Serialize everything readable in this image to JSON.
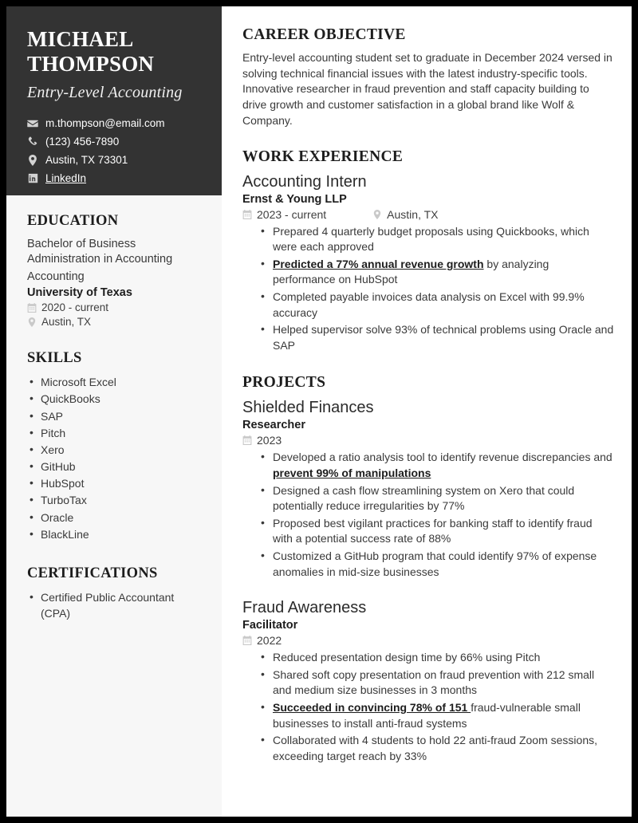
{
  "theme": {
    "page_border": "#000000",
    "header_bg": "#333333",
    "sidebar_bg": "#f7f7f7",
    "main_bg": "#ffffff",
    "text_primary": "#1d1d1d",
    "text_body": "#3a3a3a",
    "icon_muted": "#c9c9c9"
  },
  "header": {
    "first_name": "MICHAEL",
    "last_name": "THOMPSON",
    "job_title": "Entry-Level Accounting",
    "contacts": [
      {
        "icon": "envelope-icon",
        "text": "m.thompson@email.com",
        "link": false
      },
      {
        "icon": "phone-icon",
        "text": "(123) 456-7890",
        "link": false
      },
      {
        "icon": "location-pin-icon",
        "text": "Austin, TX 73301",
        "link": false
      },
      {
        "icon": "linkedin-icon",
        "text": "LinkedIn",
        "link": true
      }
    ]
  },
  "sidebar": {
    "education": {
      "heading": "EDUCATION",
      "degree": "Bachelor of Business Administration in Accounting",
      "field": "Accounting",
      "school": "University of Texas",
      "dates": "2020 - current",
      "location": "Austin, TX"
    },
    "skills": {
      "heading": "SKILLS",
      "items": [
        "Microsoft Excel",
        "QuickBooks",
        "SAP",
        "Pitch",
        "Xero",
        "GitHub",
        "HubSpot",
        "TurboTax",
        "Oracle",
        "BlackLine"
      ]
    },
    "certifications": {
      "heading": "CERTIFICATIONS",
      "items": [
        "Certified Public Accountant (CPA)"
      ]
    }
  },
  "main": {
    "objective": {
      "heading": "CAREER OBJECTIVE",
      "text": "Entry-level accounting student set to graduate in December 2024 versed in solving technical financial issues with the latest industry-specific tools. Innovative researcher in fraud prevention and staff capacity building to drive growth and customer satisfaction in a global brand like Wolf & Company."
    },
    "work_experience": {
      "heading": "WORK EXPERIENCE",
      "entries": [
        {
          "title": "Accounting Intern",
          "organization": "Ernst & Young LLP",
          "dates": "2023 - current",
          "location": "Austin, TX",
          "bullets": [
            {
              "pre": "",
              "highlight": "",
              "post": "Prepared 4 quarterly budget proposals using Quickbooks, which were each approved"
            },
            {
              "pre": "",
              "highlight": "Predicted a 77% annual revenue growth",
              "post": " by analyzing performance on HubSpot"
            },
            {
              "pre": "",
              "highlight": "",
              "post": "Completed payable invoices data analysis on Excel with 99.9% accuracy"
            },
            {
              "pre": "",
              "highlight": "",
              "post": "Helped supervisor solve 93% of technical problems using Oracle and SAP"
            }
          ]
        }
      ]
    },
    "projects": {
      "heading": "PROJECTS",
      "entries": [
        {
          "title": "Shielded Finances",
          "organization": "Researcher",
          "dates": "2023",
          "location": "",
          "bullets": [
            {
              "pre": "Developed a ratio analysis tool to identify revenue discrepancies and ",
              "highlight": "prevent 99% of manipulations",
              "post": ""
            },
            {
              "pre": "",
              "highlight": "",
              "post": "Designed a cash flow streamlining system on Xero that could potentially reduce irregularities by 77%"
            },
            {
              "pre": "",
              "highlight": "",
              "post": "Proposed best vigilant practices for banking staff to identify fraud with a potential success rate of 88%"
            },
            {
              "pre": "",
              "highlight": "",
              "post": "Customized a GitHub program that could identify 97% of expense anomalies in mid-size businesses"
            }
          ]
        },
        {
          "title": "Fraud Awareness",
          "organization": "Facilitator",
          "dates": "2022",
          "location": "",
          "bullets": [
            {
              "pre": "",
              "highlight": "",
              "post": "Reduced presentation design time by 66% using Pitch"
            },
            {
              "pre": "",
              "highlight": "",
              "post": "Shared soft copy presentation on fraud prevention with 212 small and medium size businesses in 3 months"
            },
            {
              "pre": "",
              "highlight": "Succeeded in convincing 78% of 151 ",
              "post": "fraud-vulnerable small businesses to install anti-fraud systems"
            },
            {
              "pre": "",
              "highlight": "",
              "post": "Collaborated with 4 students to hold 22 anti-fraud Zoom sessions, exceeding target reach by 33%"
            }
          ]
        }
      ]
    }
  }
}
